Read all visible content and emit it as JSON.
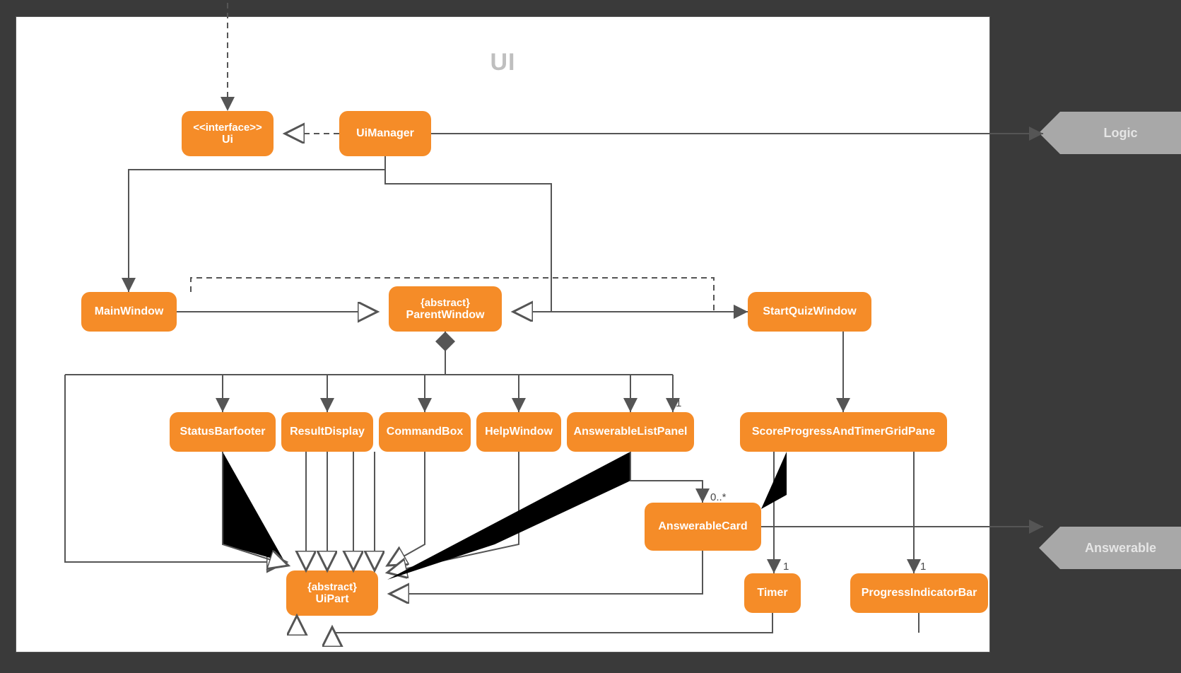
{
  "frame": {
    "title": "UI"
  },
  "external": {
    "logic": "Logic",
    "answerable": "Answerable"
  },
  "nodes": {
    "ui": {
      "stereo": "<<interface>>",
      "name": "Ui"
    },
    "uimanager": {
      "name": "UiManager"
    },
    "mainwindow": {
      "name": "MainWindow"
    },
    "parentwindow": {
      "stereo": "{abstract}",
      "name": "ParentWindow"
    },
    "startquizwindow": {
      "name": "StartQuizWindow"
    },
    "statusbarfooter": {
      "name": "StatusBarfooter"
    },
    "resultdisplay": {
      "name": "ResultDisplay"
    },
    "commandbox": {
      "name": "CommandBox"
    },
    "helpwindow": {
      "name": "HelpWindow"
    },
    "answerablelistpanel": {
      "name": "AnswerableListPanel"
    },
    "scoreprogress": {
      "name": "ScoreProgressAndTimerGridPane"
    },
    "answerablecard": {
      "name": "AnswerableCard"
    },
    "timer": {
      "name": "Timer"
    },
    "progressbar": {
      "name": "ProgressIndicatorBar"
    },
    "uipart": {
      "stereo": "{abstract}",
      "name": "UiPart"
    }
  },
  "multiplicities": {
    "answerablelistpanel": "1",
    "answerablecard": "0..*",
    "timer": "1",
    "progressbar": "1"
  }
}
